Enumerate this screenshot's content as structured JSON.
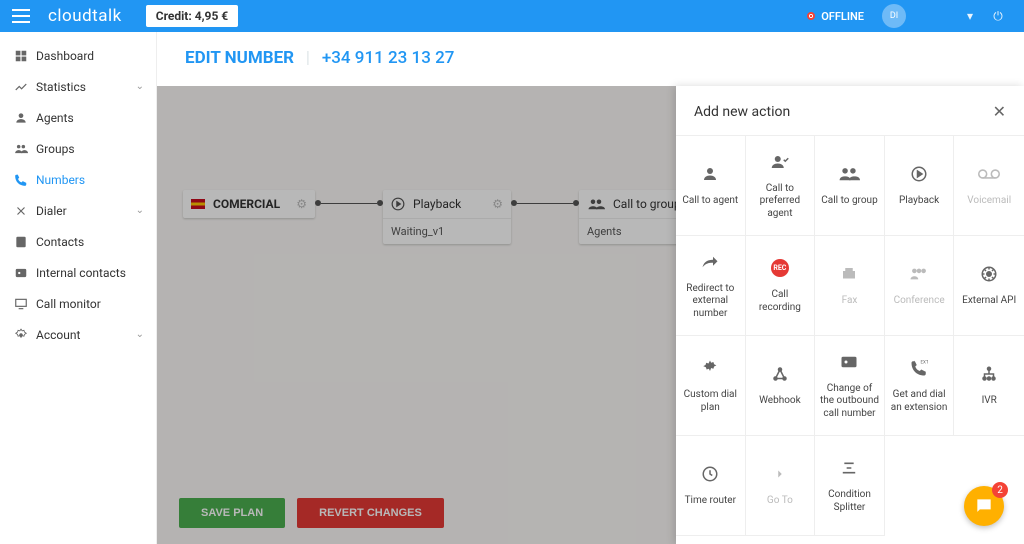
{
  "topbar": {
    "brand": "cloudtalk",
    "credit": "Credit: 4,95 €",
    "status": "OFFLINE",
    "avatar": "DI"
  },
  "sidebar": {
    "items": [
      {
        "label": "Dashboard",
        "icon": "dashboard",
        "chev": false
      },
      {
        "label": "Statistics",
        "icon": "stats",
        "chev": true
      },
      {
        "label": "Agents",
        "icon": "agent",
        "chev": false
      },
      {
        "label": "Groups",
        "icon": "groups",
        "chev": false
      },
      {
        "label": "Numbers",
        "icon": "phone",
        "chev": false,
        "active": true
      },
      {
        "label": "Dialer",
        "icon": "dialer",
        "chev": true
      },
      {
        "label": "Contacts",
        "icon": "contacts",
        "chev": false
      },
      {
        "label": "Internal contacts",
        "icon": "internal",
        "chev": false
      },
      {
        "label": "Call monitor",
        "icon": "monitor",
        "chev": false
      },
      {
        "label": "Account",
        "icon": "account",
        "chev": true
      }
    ]
  },
  "page": {
    "title": "EDIT NUMBER",
    "number": "+34 911 23 13 27"
  },
  "flow": {
    "n1": {
      "label": "COMERCIAL"
    },
    "n2": {
      "label": "Playback",
      "body": "Waiting_v1"
    },
    "n3": {
      "label": "Call to group",
      "body": "Agents"
    }
  },
  "buttons": {
    "save": "SAVE PLAN",
    "revert": "REVERT CHANGES"
  },
  "panel": {
    "title": "Add new action",
    "tiles": [
      {
        "label": "Call to agent",
        "icon": "person"
      },
      {
        "label": "Call to preferred agent",
        "icon": "person-check"
      },
      {
        "label": "Call to group",
        "icon": "group"
      },
      {
        "label": "Playback",
        "icon": "play"
      },
      {
        "label": "Voicemail",
        "icon": "voicemail",
        "muted": true
      },
      {
        "label": "Redirect to external number",
        "icon": "redirect"
      },
      {
        "label": "Call recording",
        "icon": "rec"
      },
      {
        "label": "Fax",
        "icon": "fax",
        "muted": true
      },
      {
        "label": "Conference",
        "icon": "conference",
        "muted": true
      },
      {
        "label": "External API",
        "icon": "api"
      },
      {
        "label": "Custom dial plan",
        "icon": "gear"
      },
      {
        "label": "Webhook",
        "icon": "webhook"
      },
      {
        "label": "Change of the outbound call number",
        "icon": "card"
      },
      {
        "label": "Get and dial an extension",
        "icon": "ext"
      },
      {
        "label": "IVR",
        "icon": "ivr"
      },
      {
        "label": "Time router",
        "icon": "clock"
      },
      {
        "label": "Go To",
        "icon": "goto",
        "muted": true
      },
      {
        "label": "Condition Splitter",
        "icon": "splitter"
      }
    ]
  },
  "chat": {
    "badge": "2"
  }
}
